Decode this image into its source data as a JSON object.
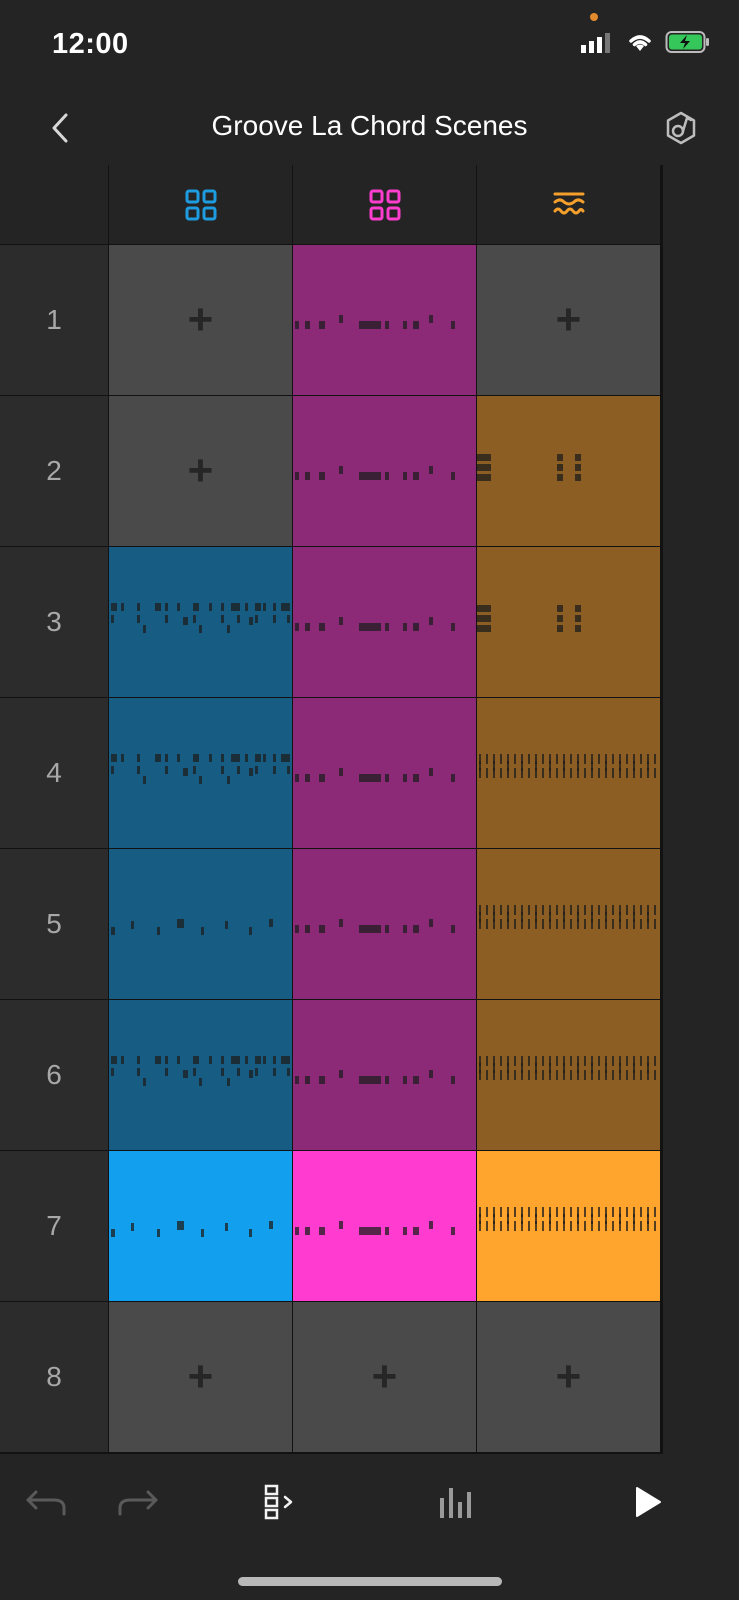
{
  "status": {
    "time": "12:00"
  },
  "nav": {
    "title": "Groove La Chord Scenes"
  },
  "tracks": [
    {
      "icon": "drum-grid-icon",
      "color": "#1e9ce0"
    },
    {
      "icon": "drum-grid-icon",
      "color": "#ff3dcf"
    },
    {
      "icon": "waveform-icon",
      "color": "#f5a02c"
    }
  ],
  "rows": [
    "1",
    "2",
    "3",
    "4",
    "5",
    "6",
    "7",
    "8"
  ],
  "colors": {
    "blue_dim": "#165c83",
    "pink_dim": "#8c2a78",
    "orange_dim": "#8c5e23",
    "blue_active": "#12a0ee",
    "pink_active": "#ff3ccf",
    "orange_active": "#ffa42c",
    "empty": "#4a4a4a"
  },
  "grid": [
    [
      "empty",
      "pink",
      "empty"
    ],
    [
      "empty",
      "pink",
      "orangeA"
    ],
    [
      "blueA",
      "pink",
      "orangeA"
    ],
    [
      "blueA",
      "pink",
      "orangeB"
    ],
    [
      "blueB",
      "pink",
      "orangeB"
    ],
    [
      "blueA",
      "pink",
      "orangeB"
    ],
    [
      "blueB",
      "pink",
      "orangeB"
    ],
    [
      "empty",
      "empty",
      "empty"
    ]
  ],
  "active_row": 7,
  "toolbar": [
    "undo-icon",
    "redo-icon",
    "scene-launch-icon",
    "mixer-icon",
    "play-icon"
  ]
}
